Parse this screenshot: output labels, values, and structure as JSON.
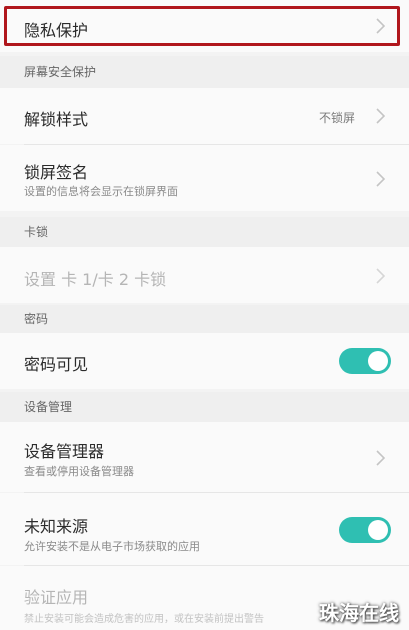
{
  "privacy": {
    "label": "隐私保护"
  },
  "sections": {
    "screen_security": "屏幕安全保护",
    "sim_lock": "卡锁",
    "password": "密码",
    "device_management": "设备管理"
  },
  "unlock_style": {
    "label": "解锁样式",
    "value": "不锁屏"
  },
  "lockscreen_signature": {
    "label": "锁屏签名",
    "desc": "设置的信息将会显示在锁屏界面"
  },
  "sim_lock_setting": {
    "label": "设置 卡 1/卡 2 卡锁"
  },
  "password_visible": {
    "label": "密码可见",
    "enabled": true
  },
  "device_manager": {
    "label": "设备管理器",
    "desc": "查看或停用设备管理器"
  },
  "unknown_sources": {
    "label": "未知来源",
    "desc": "允许安装不是从电子市场获取的应用",
    "enabled": true
  },
  "verify_apps": {
    "label": "验证应用",
    "desc": "禁止安装可能会造成危害的应用，或在安装前提出警告"
  },
  "colors": {
    "accent": "#2fbfb2",
    "highlight": "#b0161c"
  },
  "watermark": "珠海在线"
}
